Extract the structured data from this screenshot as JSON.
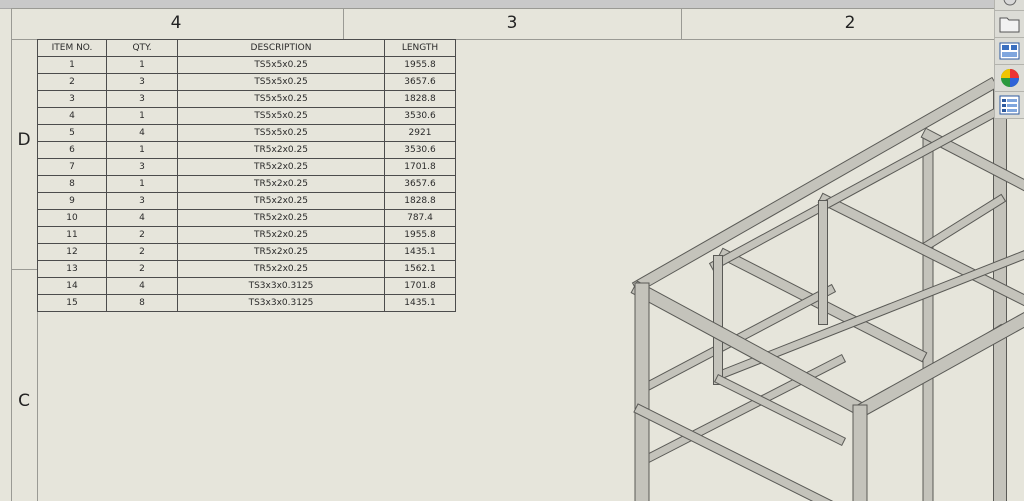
{
  "sheet": {
    "zones_columns": [
      "4",
      "3",
      "2"
    ],
    "zones_rows": [
      "D",
      "C"
    ]
  },
  "bom_table": {
    "headers": [
      "ITEM NO.",
      "QTY.",
      "DESCRIPTION",
      "LENGTH"
    ],
    "rows": [
      [
        "1",
        "1",
        "TS5x5x0.25",
        "1955.8"
      ],
      [
        "2",
        "3",
        "TS5x5x0.25",
        "3657.6"
      ],
      [
        "3",
        "3",
        "TS5x5x0.25",
        "1828.8"
      ],
      [
        "4",
        "1",
        "TS5x5x0.25",
        "3530.6"
      ],
      [
        "5",
        "4",
        "TS5x5x0.25",
        "2921"
      ],
      [
        "6",
        "1",
        "TR5x2x0.25",
        "3530.6"
      ],
      [
        "7",
        "3",
        "TR5x2x0.25",
        "1701.8"
      ],
      [
        "8",
        "1",
        "TR5x2x0.25",
        "3657.6"
      ],
      [
        "9",
        "3",
        "TR5x2x0.25",
        "1828.8"
      ],
      [
        "10",
        "4",
        "TR5x2x0.25",
        "787.4"
      ],
      [
        "11",
        "2",
        "TR5x2x0.25",
        "1955.8"
      ],
      [
        "12",
        "2",
        "TR5x2x0.25",
        "1435.1"
      ],
      [
        "13",
        "2",
        "TR5x2x0.25",
        "1562.1"
      ],
      [
        "14",
        "4",
        "TS3x3x0.3125",
        "1701.8"
      ],
      [
        "15",
        "8",
        "TS3x3x0.3125",
        "1435.1"
      ]
    ]
  },
  "toolbar": {
    "icons": [
      "design-library-icon",
      "file-explorer-icon",
      "view-palette-icon",
      "appearances-icon",
      "custom-properties-icon"
    ]
  },
  "colors": {
    "sheet_background": "#e6e5db",
    "frame_line": "#9a9a94",
    "steel_light": "#c4c3bb",
    "steel_dark": "#5a5a56"
  }
}
